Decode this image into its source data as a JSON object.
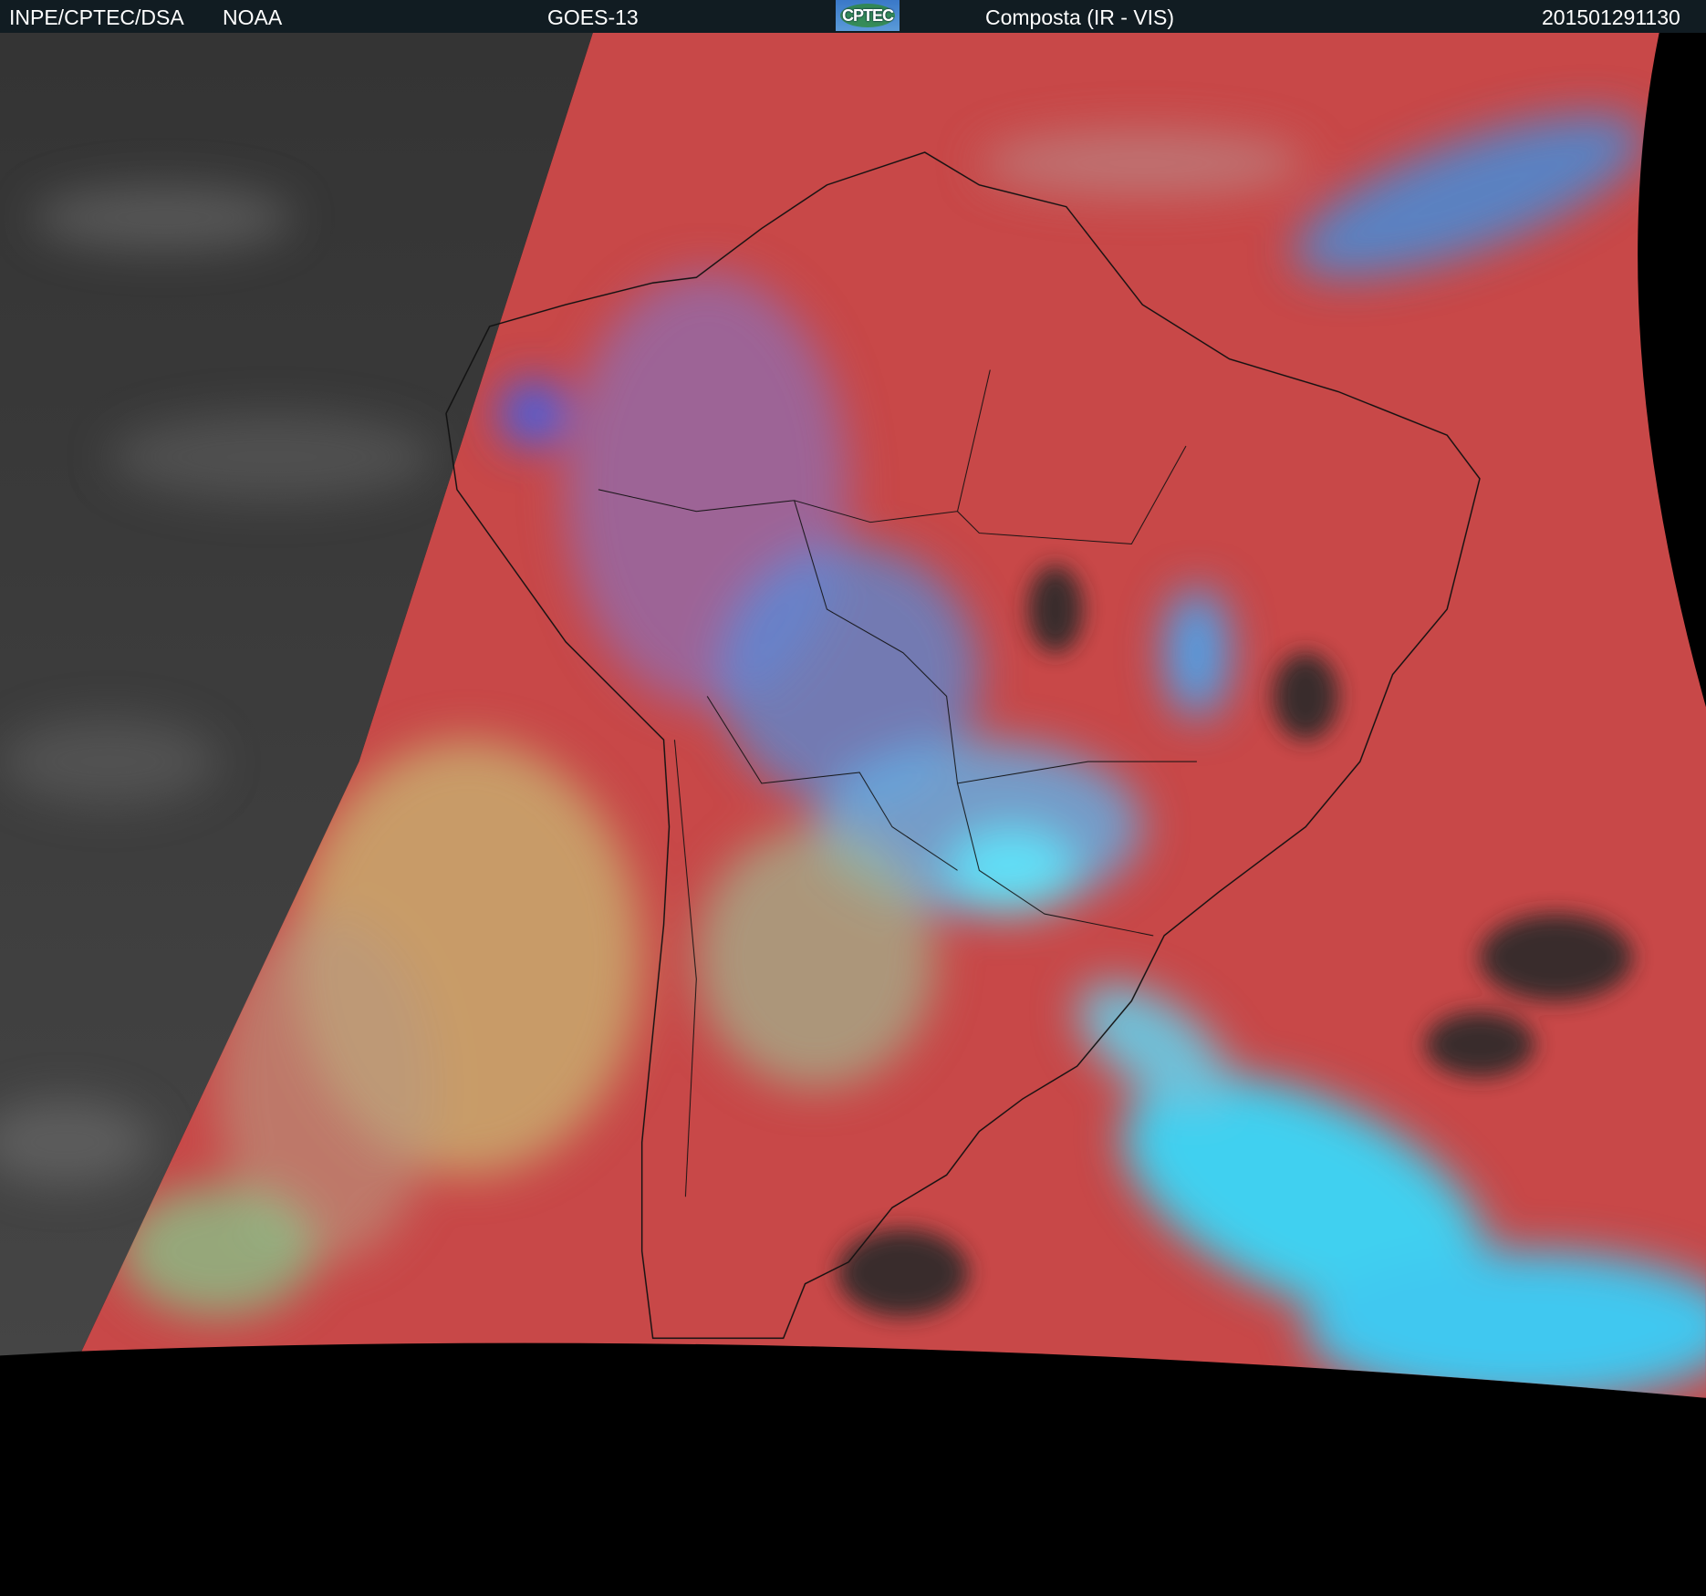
{
  "header": {
    "agency": "INPE/CPTEC/DSA",
    "noaa": "NOAA",
    "satellite": "GOES-13",
    "logo_text": "CPTEC",
    "product": "Composta (IR - VIS)",
    "datetime": "201501291130"
  },
  "colors": {
    "header_bg": "#111c22",
    "ocean_red": "#c84848",
    "cloud_cyan": "#40d8f0",
    "ir_gray": "#3a3a3a"
  }
}
